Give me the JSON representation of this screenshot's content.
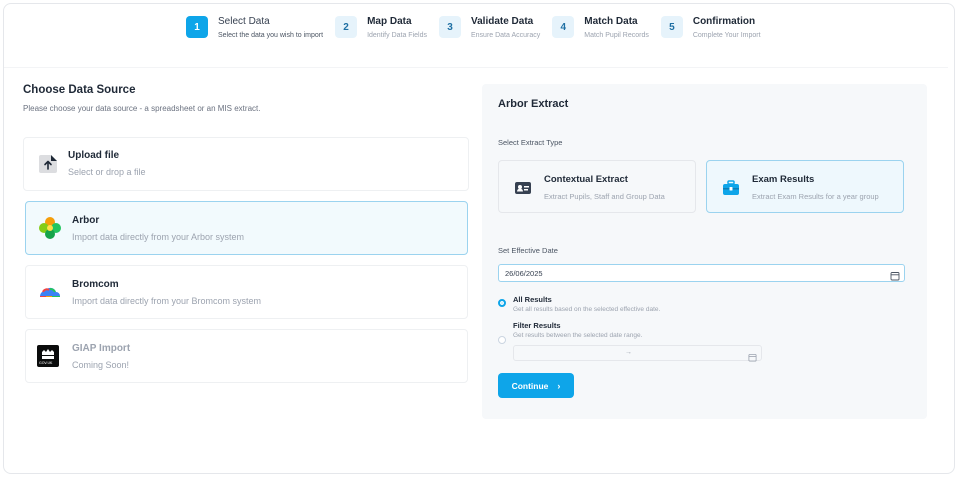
{
  "stepper": {
    "steps": [
      {
        "num": "1",
        "title": "Select Data",
        "sub": "Select the data you wish to import"
      },
      {
        "num": "2",
        "title": "Map Data",
        "sub": "Identify Data Fields"
      },
      {
        "num": "3",
        "title": "Validate Data",
        "sub": "Ensure Data Accuracy"
      },
      {
        "num": "4",
        "title": "Match Data",
        "sub": "Match Pupil Records"
      },
      {
        "num": "5",
        "title": "Confirmation",
        "sub": "Complete Your Import"
      }
    ]
  },
  "left": {
    "title": "Choose Data Source",
    "subtitle": "Please choose your data source - a spreadsheet or an MIS extract.",
    "sources": [
      {
        "title": "Upload file",
        "desc": "Select or drop a file",
        "icon": "upload-file-icon"
      },
      {
        "title": "Arbor",
        "desc": "Import data directly from your Arbor system",
        "icon": "arbor-logo"
      },
      {
        "title": "Bromcom",
        "desc": "Import data directly from your Bromcom system",
        "icon": "bromcom-logo"
      },
      {
        "title": "GIAP Import",
        "desc": "Coming Soon!",
        "icon": "govuk-crest-icon",
        "crest_text": "GOV.UK"
      }
    ]
  },
  "panel": {
    "title": "Arbor Extract",
    "extract_type_label": "Select Extract Type",
    "extract_types": [
      {
        "title": "Contextual Extract",
        "desc": "Extract Pupils, Staff and Group Data"
      },
      {
        "title": "Exam Results",
        "desc": "Extract Exam Results for a year group"
      }
    ],
    "effective_date_label": "Set Effective Date",
    "effective_date_value": "26/06/2025",
    "options": [
      {
        "title": "All Results",
        "desc": "Get all results based on the selected effective date."
      },
      {
        "title": "Filter Results",
        "desc": "Get results between the selected date range."
      }
    ],
    "range_separator": "→",
    "continue_label": "Continue",
    "continue_chevron": "›"
  },
  "colors": {
    "accent": "#0ea5e9",
    "selected_border": "#9bd3ef"
  }
}
